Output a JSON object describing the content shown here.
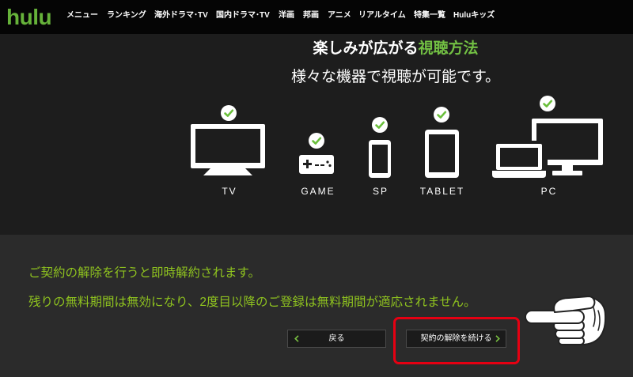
{
  "nav": {
    "logo": "hulu",
    "items": [
      "メニュー",
      "ランキング",
      "海外ドラマ･TV",
      "国内ドラマ･TV",
      "洋画",
      "邦画",
      "アニメ",
      "リアルタイム",
      "特集一覧",
      "Huluキッズ"
    ]
  },
  "devices_section": {
    "title_main": "楽しみが広がる",
    "title_accent": "視聴方法",
    "subtitle": "様々な機器で視聴が可能です。",
    "check_icon": "check-circle-icon",
    "devices": [
      {
        "label": "TV",
        "icon": "tv-icon"
      },
      {
        "label": "GAME",
        "icon": "game-controller-icon"
      },
      {
        "label": "SP",
        "icon": "smartphone-icon"
      },
      {
        "label": "TABLET",
        "icon": "tablet-icon"
      },
      {
        "label": "PC",
        "icon": "pc-icon"
      }
    ]
  },
  "cancel_section": {
    "notice_1": "ご契約の解除を行うと即時解約されます。",
    "notice_2": "残りの無料期間は無効になり、2度目以降のご登録は無料期間が適応されません。",
    "back_button": {
      "label": "戻る",
      "icon": "chevron-left-icon"
    },
    "continue_button": {
      "label": "契約の解除を続ける",
      "icon": "chevron-right-icon"
    }
  },
  "annotation": {
    "highlight": "red-rounded-box",
    "hand_icon": "pointing-hand-icon"
  },
  "colors": {
    "brand_green": "#66b23a",
    "accent_green": "#72c043",
    "notice_green": "#8fc31f",
    "check_green": "#6abf3b",
    "annotation_red": "#e60012",
    "nav_bg": "#050505",
    "section_bg": "#1d1d1d",
    "cancel_bg": "#2b2b2b"
  }
}
